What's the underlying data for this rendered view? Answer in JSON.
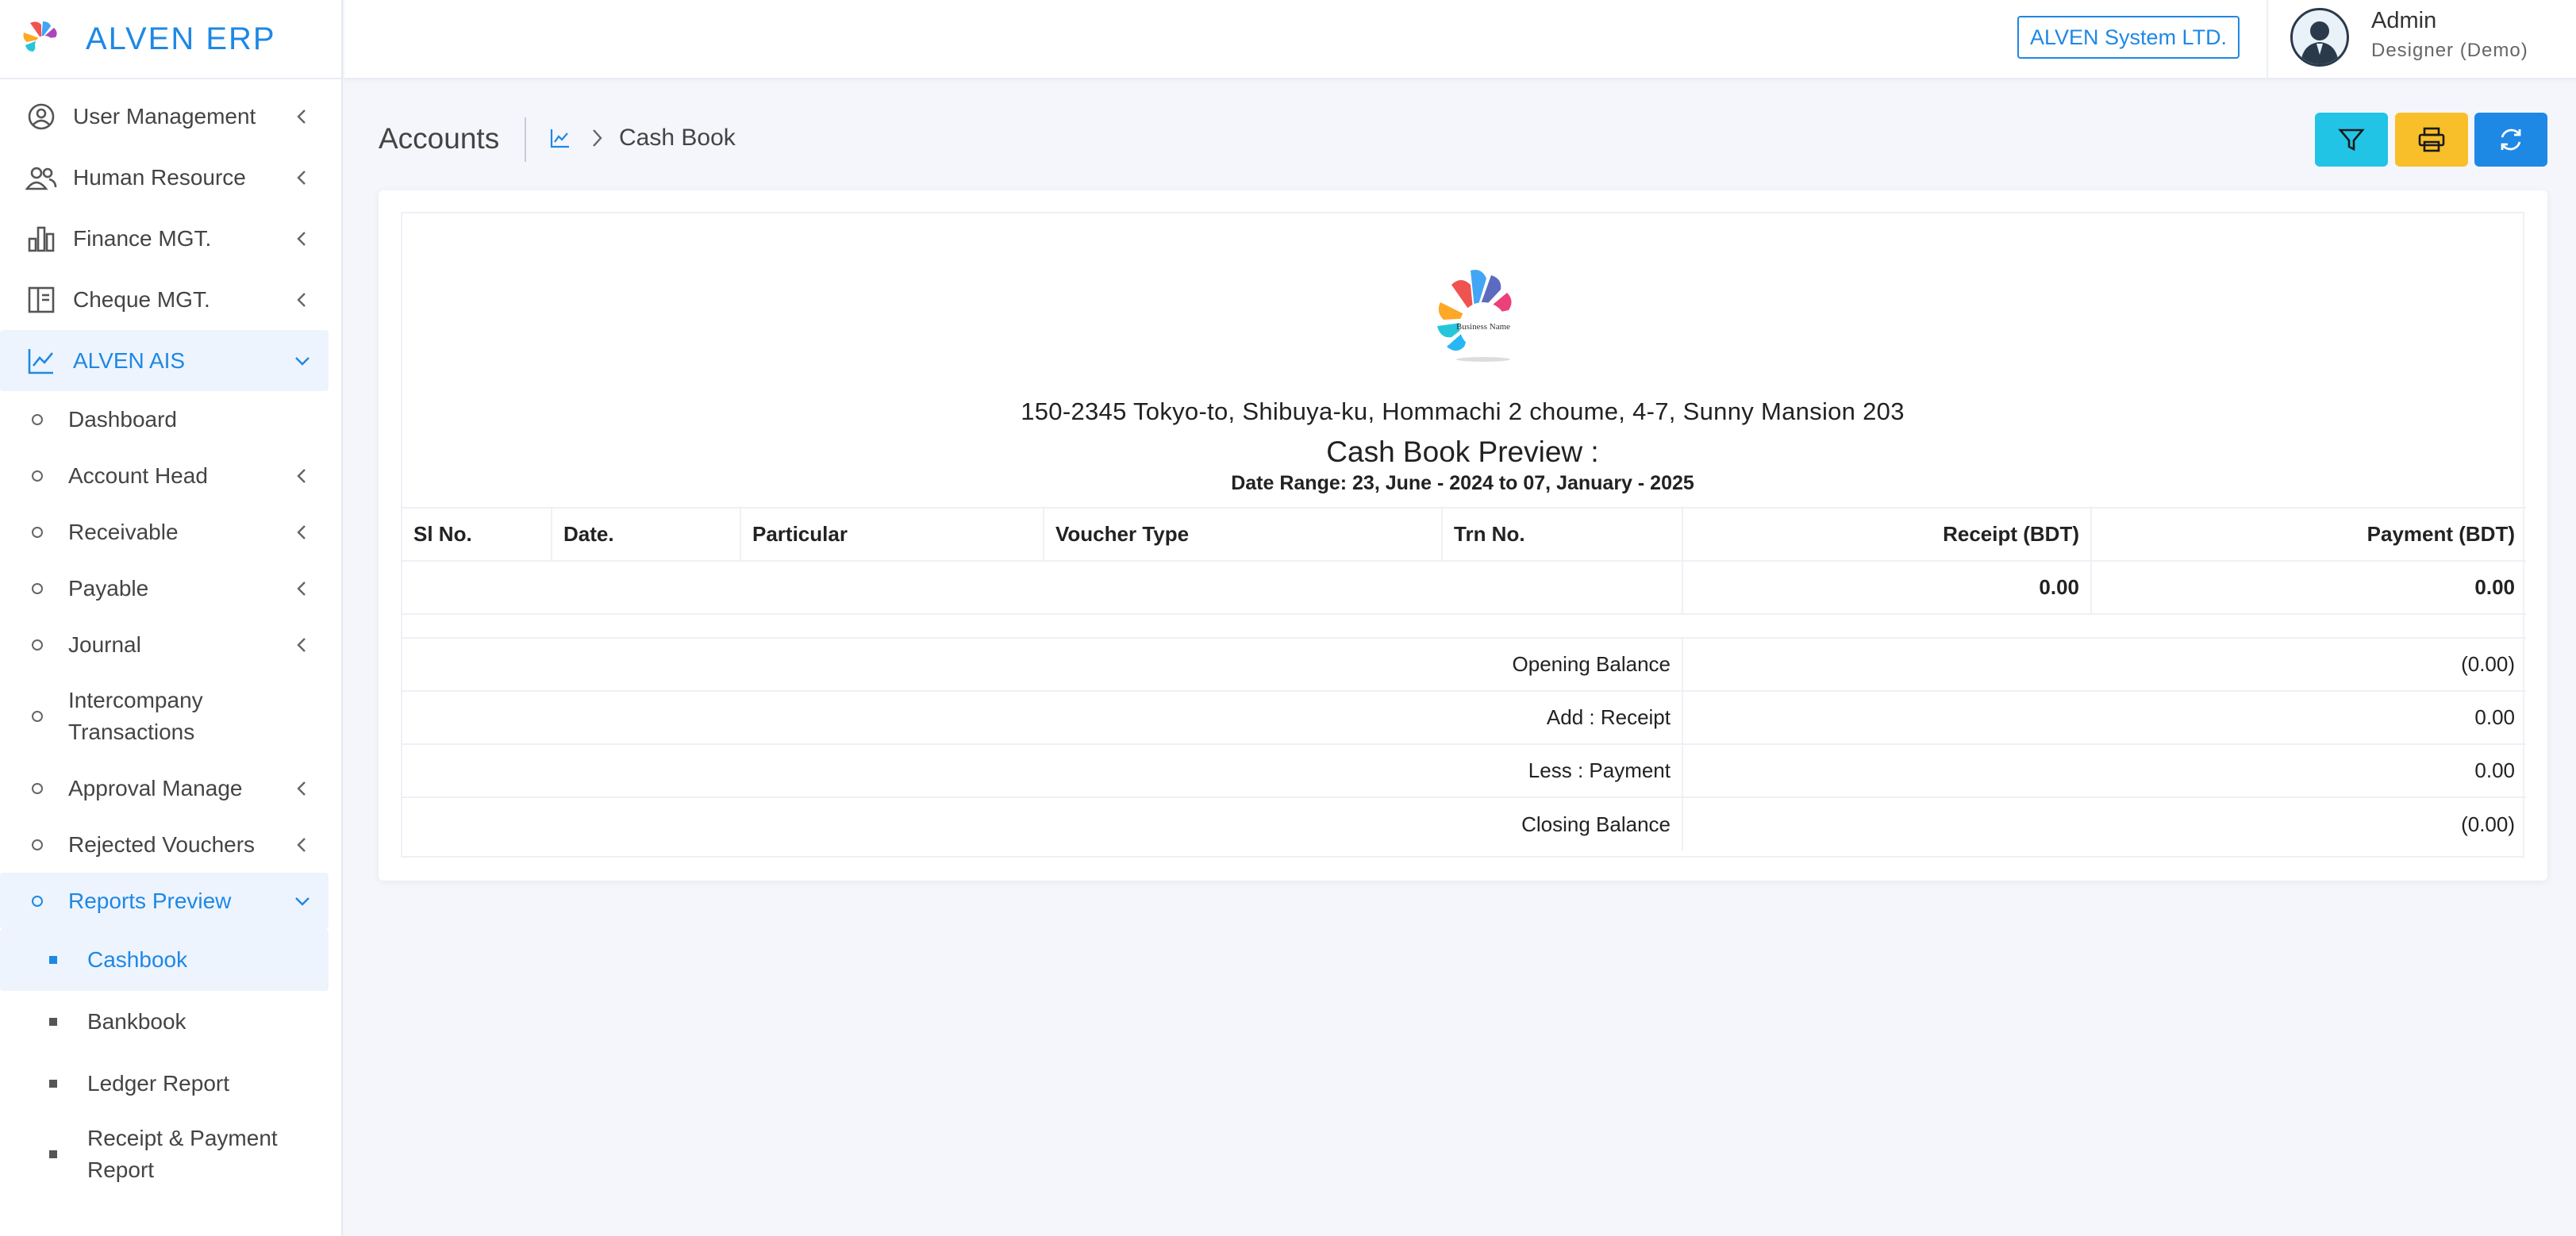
{
  "app": {
    "name": "ALVEN ERP",
    "brand_color": "#1e88e5"
  },
  "sidebar": {
    "items": [
      {
        "label": "User Management",
        "icon": "user-circle-icon"
      },
      {
        "label": "Human Resource",
        "icon": "users-icon"
      },
      {
        "label": "Finance MGT.",
        "icon": "bar-chart-icon"
      },
      {
        "label": "Cheque MGT.",
        "icon": "cheque-icon"
      },
      {
        "label": "ALVEN AIS",
        "icon": "line-chart-icon",
        "expanded": true
      }
    ],
    "ais_items": [
      {
        "label": "Dashboard"
      },
      {
        "label": "Account Head"
      },
      {
        "label": "Receivable"
      },
      {
        "label": "Payable"
      },
      {
        "label": "Journal"
      },
      {
        "label": "Intercompany Transactions"
      },
      {
        "label": "Approval Manage"
      },
      {
        "label": "Rejected Vouchers"
      },
      {
        "label": "Reports Preview",
        "expanded": true
      }
    ],
    "report_items": [
      {
        "label": "Cashbook",
        "active": true
      },
      {
        "label": "Bankbook"
      },
      {
        "label": "Ledger Report"
      },
      {
        "label": "Receipt & Payment Report"
      }
    ]
  },
  "topbar": {
    "company": "ALVEN System LTD.",
    "user_name": "Admin",
    "user_role": "Designer (Demo)"
  },
  "page": {
    "title": "Accounts",
    "breadcrumb_current": "Cash Book",
    "buttons": {
      "filter": "filter-icon",
      "print": "printer-icon",
      "refresh": "refresh-icon"
    },
    "button_colors": {
      "filter": "#22c4e6",
      "print": "#f8bf2a",
      "refresh": "#1e88e5"
    }
  },
  "report": {
    "logo_text": "Business Name",
    "address": "150-2345 Tokyo-to, Shibuya-ku, Hommachi 2 choume, 4-7, Sunny Mansion 203",
    "title": "Cash Book Preview :",
    "date_range": "Date Range: 23, June - 2024 to 07, January - 2025",
    "columns": [
      "Sl No.",
      "Date.",
      "Particular",
      "Voucher Type",
      "Trn No.",
      "Receipt (BDT)",
      "Payment (BDT)"
    ],
    "totals": {
      "receipt": "0.00",
      "payment": "0.00"
    },
    "summary": [
      {
        "label": "Opening Balance",
        "value": "(0.00)"
      },
      {
        "label": "Add : Receipt",
        "value": "0.00"
      },
      {
        "label": "Less : Payment",
        "value": "0.00"
      },
      {
        "label": "Closing Balance",
        "value": "(0.00)"
      }
    ]
  }
}
